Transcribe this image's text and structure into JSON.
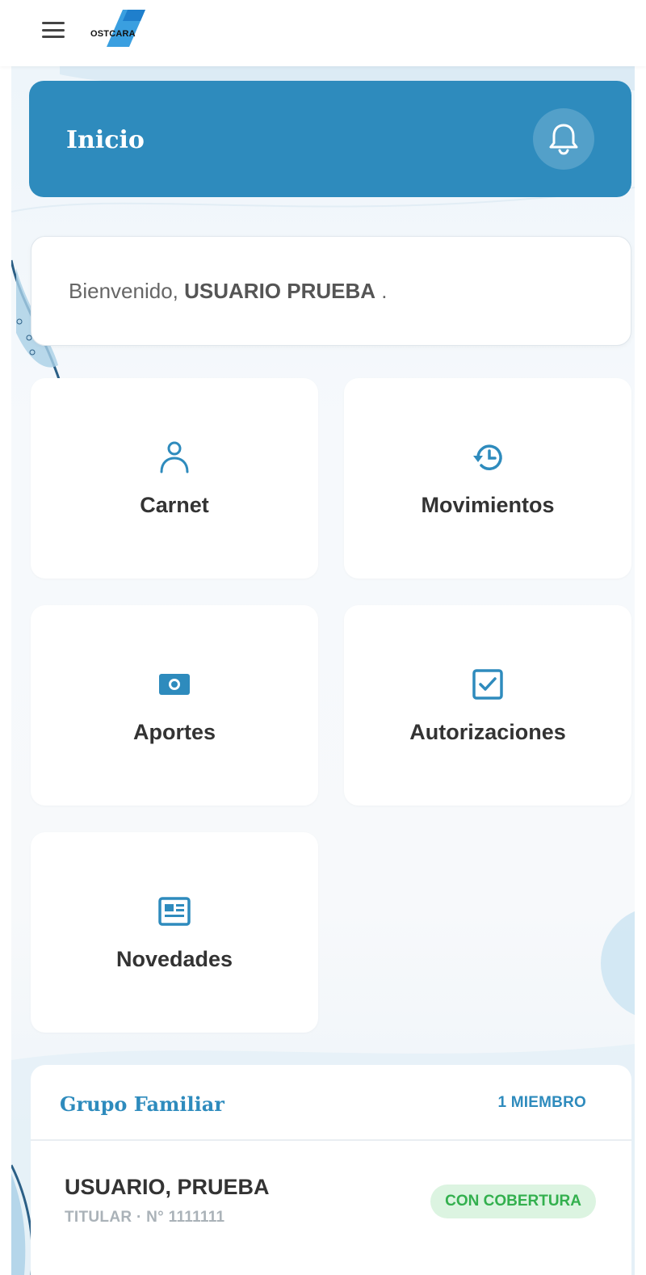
{
  "app": {
    "logo_text": "OSTCARA",
    "brand_color": "#2e8bbd"
  },
  "header": {
    "title": "Inicio",
    "bell_icon": "bell-icon"
  },
  "welcome": {
    "greeting": "Bienvenido,",
    "user_name": "USUARIO PRUEBA",
    "suffix": " ."
  },
  "tiles": [
    {
      "label": "Carnet",
      "icon": "person-icon"
    },
    {
      "label": "Movimientos",
      "icon": "history-icon"
    },
    {
      "label": "Aportes",
      "icon": "money-icon"
    },
    {
      "label": "Autorizaciones",
      "icon": "checkbox-icon"
    },
    {
      "label": "Novedades",
      "icon": "newspaper-icon"
    }
  ],
  "family": {
    "title": "Grupo Familiar",
    "count": "1 MIEMBRO",
    "members": [
      {
        "name": "USUARIO, PRUEBA",
        "subtitle": "TITULAR · N° 1111111",
        "status": "CON COBERTURA",
        "status_color": "#33b04e"
      }
    ]
  }
}
